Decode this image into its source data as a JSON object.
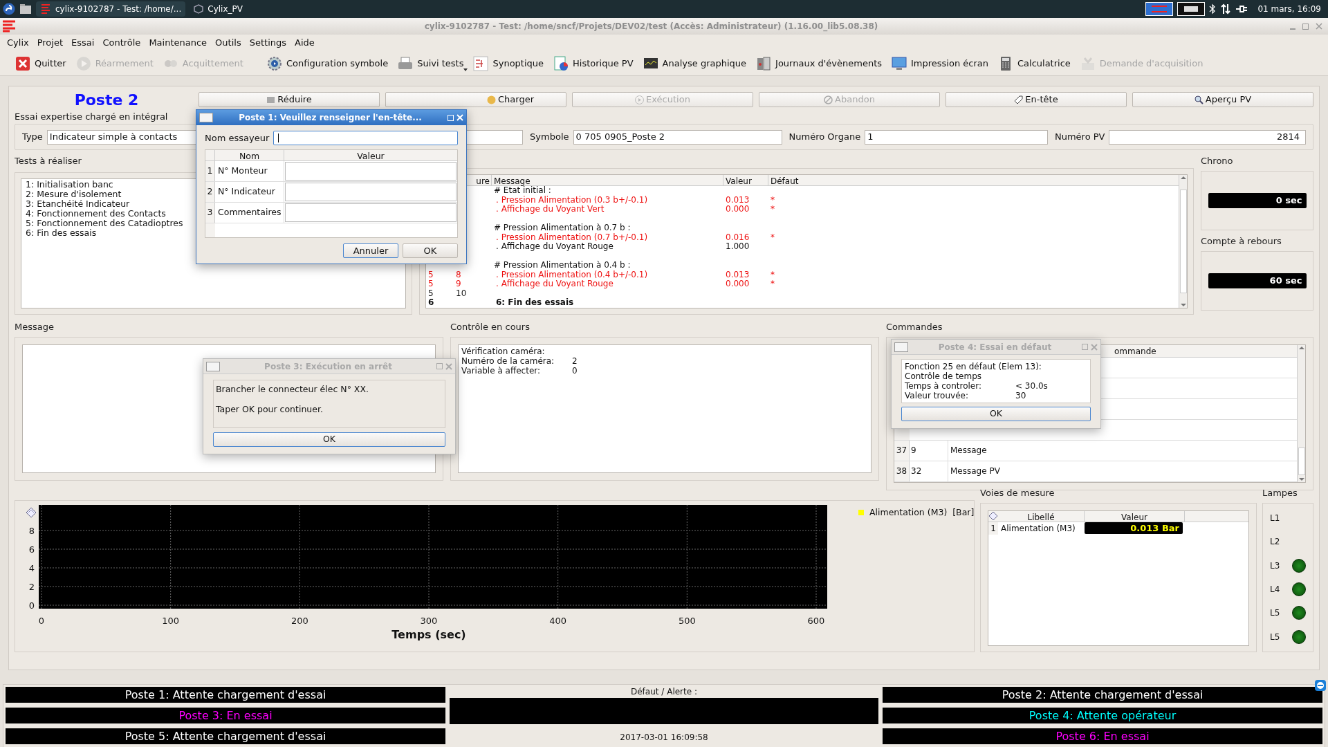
{
  "taskbar": {
    "windows": [
      {
        "title": "cylix-9102787 - Test: /home/...",
        "selected": true
      },
      {
        "title": "Cylix_PV",
        "selected": false
      }
    ],
    "clock": "01 mars, 16:09"
  },
  "window": {
    "title": "cylix-9102787 - Test: /home/sncf/Projets/DEV02/test (Accès: Administrateur) (1.16.00_lib5.08.38)"
  },
  "menu": [
    "Cylix",
    "Projet",
    "Essai",
    "Contrôle",
    "Maintenance",
    "Outils",
    "Settings",
    "Aide"
  ],
  "toolbar": [
    {
      "kind": "quit",
      "label": "Quitter",
      "disabled": false
    },
    {
      "kind": "reset",
      "label": "Réarmement",
      "disabled": true
    },
    {
      "kind": "ack",
      "label": "Acquittement",
      "disabled": true
    },
    {
      "kind": "config",
      "label": "Configuration symbole",
      "disabled": false
    },
    {
      "kind": "tracking",
      "label": "Suivi tests",
      "disabled": false,
      "dropdown": true
    },
    {
      "kind": "synoptic",
      "label": "Synoptique",
      "disabled": false
    },
    {
      "kind": "history",
      "label": "Historique PV",
      "disabled": false
    },
    {
      "kind": "analysis",
      "label": "Analyse graphique",
      "disabled": false
    },
    {
      "kind": "journal",
      "label": "Journaux d'évènements",
      "disabled": false
    },
    {
      "kind": "print",
      "label": "Impression écran",
      "disabled": false
    },
    {
      "kind": "calculator",
      "label": "Calculatrice",
      "disabled": false
    },
    {
      "kind": "acquisition",
      "label": "Demande d'acquisition",
      "disabled": true
    }
  ],
  "station": {
    "title": "Poste 2",
    "subtitle": "Essai expertise chargé en intégral",
    "buttons": [
      {
        "kind": "reduce",
        "label": "Réduire",
        "disabled": false
      },
      {
        "kind": "load",
        "label": "Charger",
        "disabled": false
      },
      {
        "kind": "run",
        "label": "Exécution",
        "disabled": true
      },
      {
        "kind": "abort",
        "label": "Abandon",
        "disabled": true
      },
      {
        "kind": "header",
        "label": "En-tête",
        "disabled": false
      },
      {
        "kind": "preview",
        "label": "Aperçu PV",
        "disabled": false
      }
    ],
    "fields": [
      {
        "label": "Type",
        "value": "Indicateur simple à contacts"
      },
      {
        "label": "Symbole",
        "value": "0 705 0905_Poste 2"
      },
      {
        "label": "Numéro Organe",
        "value": "1"
      },
      {
        "label": "Numéro PV",
        "value": "2814"
      }
    ]
  },
  "tests": {
    "title": "Tests à réaliser",
    "items": [
      "1: Initialisation banc",
      "2: Mesure d'isolement",
      "3: Etanchéité Indicateur",
      "4: Fonctionnement des Contacts",
      "5: Fonctionnement des Catadioptres",
      "6: Fin des essais"
    ]
  },
  "results": {
    "columns": [
      "ure",
      "Message",
      "Valeur",
      "Défaut"
    ],
    "rows": [
      {
        "kind": "heading",
        "message": "# Etat initial :"
      },
      {
        "kind": "check",
        "failed": true,
        "message": ". Pression Alimentation (0.3 b+/-0.1)",
        "value": "0.013",
        "flag": "*"
      },
      {
        "kind": "check",
        "failed": true,
        "message": ". Affichage du Voyant Vert",
        "value": "0.000",
        "flag": "*"
      },
      {
        "kind": "blank"
      },
      {
        "kind": "heading",
        "message": "# Pression Alimentation à 0.7 b :"
      },
      {
        "kind": "check",
        "failed": true,
        "message": ". Pression Alimentation (0.7 b+/-0.1)",
        "value": "0.016",
        "flag": "*"
      },
      {
        "kind": "check",
        "failed": false,
        "message": ". Affichage du Voyant Rouge",
        "value": "1.000"
      },
      {
        "kind": "blank"
      },
      {
        "kind": "heading",
        "message": "# Pression Alimentation à 0.4 b :"
      },
      {
        "kind": "check",
        "failed": true,
        "c1": "5",
        "c2": "8",
        "message": ". Pression Alimentation (0.4 b+/-0.1)",
        "value": "0.013",
        "flag": "*"
      },
      {
        "kind": "check",
        "failed": true,
        "c1": "5",
        "c2": "9",
        "message": ". Affichage du Voyant Rouge",
        "value": "0.000",
        "flag": "*"
      },
      {
        "kind": "check",
        "failed": false,
        "c1": "5",
        "c2": "10"
      },
      {
        "kind": "section",
        "c1": "6",
        "message": "6: Fin des essais"
      }
    ]
  },
  "chrono": {
    "title": "Chrono",
    "value": "0 sec"
  },
  "countdown": {
    "title": "Compte à rebours",
    "value": "60 sec"
  },
  "message_panel": {
    "title": "Message"
  },
  "control": {
    "title": "Contrôle en cours",
    "lines": [
      {
        "label": "Vérification caméra:"
      },
      {
        "label": "Numéro de la caméra:",
        "value": "2"
      },
      {
        "label": "Variable à affecter:",
        "value": "0"
      }
    ]
  },
  "commands": {
    "title": "Commandes",
    "columns": [
      "ommande"
    ],
    "rows": [
      {
        "index": "37",
        "c1": "9",
        "c2": "Message"
      },
      {
        "index": "38",
        "c1": "32",
        "c2": "Message PV"
      }
    ]
  },
  "plot": {
    "xlabel": "Temps (sec)",
    "x_ticks": [
      "0",
      "100",
      "200",
      "300",
      "400",
      "500",
      "600"
    ],
    "y_ticks": [
      "8",
      "6",
      "4",
      "2",
      "0"
    ],
    "legend": [
      {
        "name": "Alimentation (M3)  [Bar]",
        "color": "#ffff00"
      }
    ]
  },
  "channels": {
    "title": "Voies de mesure",
    "columns": [
      "Libellé",
      "Valeur"
    ],
    "rows": [
      {
        "index": "1",
        "label": "Alimentation (M3)",
        "value": "0.013 Bar"
      }
    ]
  },
  "lamps": {
    "title": "Lampes",
    "items": [
      {
        "label": "L1",
        "on": false
      },
      {
        "label": "L2",
        "on": false
      },
      {
        "label": "L3",
        "on": true
      },
      {
        "label": "L4",
        "on": true
      },
      {
        "label": "L5",
        "on": true
      },
      {
        "label": "L5",
        "on": true
      }
    ]
  },
  "status": {
    "left": [
      {
        "text": "Poste 1: Attente chargement d'essai",
        "kind": "idle"
      },
      {
        "text": "Poste 3: En essai",
        "kind": "running"
      },
      {
        "text": "Poste 5: Attente chargement d'essai",
        "kind": "idle"
      }
    ],
    "alert_title": "Défaut / Alerte :",
    "timestamp": "2017-03-01 16:09:58",
    "right": [
      {
        "text": "Poste 2: Attente chargement d'essai",
        "kind": "idle"
      },
      {
        "text": "Poste 4: Attente opérateur",
        "kind": "waiting"
      },
      {
        "text": "Poste 6: En essai",
        "kind": "running"
      }
    ]
  },
  "header_dialog": {
    "active": true,
    "title": "Poste 1: Veuillez renseigner l'en-tête...",
    "field_label": "Nom essayeur",
    "columns": [
      "Nom",
      "Valeur"
    ],
    "rows": [
      {
        "index": "1",
        "name": "N° Monteur"
      },
      {
        "index": "2",
        "name": "N° Indicateur"
      },
      {
        "index": "3",
        "name": "Commentaires"
      }
    ],
    "buttons": [
      "Annuler",
      "OK"
    ]
  },
  "stop_dialog": {
    "active": false,
    "title": "Poste 3: Exécution en arrêt",
    "lines": [
      "Brancher le connecteur élec N° XX.",
      "Taper OK pour continuer."
    ],
    "button": "OK"
  },
  "fault_dialog": {
    "active": false,
    "title": "Poste 4: Essai en défaut",
    "lines": [
      "Fonction 25 en défaut (Elem 13):",
      "Contrôle de temps"
    ],
    "pairs": [
      {
        "label": "Temps à controler:",
        "value": "< 30.0s"
      },
      {
        "label": "Valeur trouvée:",
        "value": "30"
      }
    ],
    "button": "OK"
  }
}
